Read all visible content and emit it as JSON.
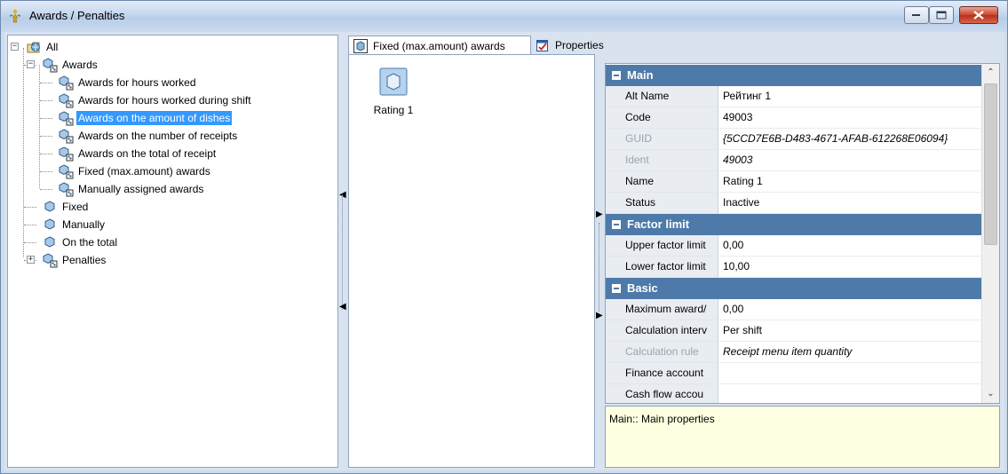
{
  "window": {
    "title": "Awards / Penalties"
  },
  "tree": {
    "rows": [
      {
        "label": "All",
        "indent": 0,
        "expander": "−",
        "icon": "folder-globe-icon",
        "selected": false
      },
      {
        "label": "Awards",
        "indent": 1,
        "expander": "−",
        "icon": "group-node-icon",
        "selected": false
      },
      {
        "label": "Awards for hours worked",
        "indent": 2,
        "expander": "",
        "icon": "group-node-icon",
        "selected": false
      },
      {
        "label": "Awards for hours worked during shift",
        "indent": 2,
        "expander": "",
        "icon": "group-node-icon",
        "selected": false
      },
      {
        "label": "Awards on the amount of dishes",
        "indent": 2,
        "expander": "",
        "icon": "group-node-icon",
        "selected": true
      },
      {
        "label": "Awards on the number of receipts",
        "indent": 2,
        "expander": "",
        "icon": "group-node-icon",
        "selected": false
      },
      {
        "label": "Awards on the total of receipt",
        "indent": 2,
        "expander": "",
        "icon": "group-node-icon",
        "selected": false
      },
      {
        "label": "Fixed (max.amount) awards",
        "indent": 2,
        "expander": "",
        "icon": "group-node-icon",
        "selected": false
      },
      {
        "label": "Manually assigned awards",
        "indent": 2,
        "expander": "",
        "icon": "group-node-icon",
        "selected": false
      },
      {
        "label": "Fixed",
        "indent": 1,
        "expander": "",
        "icon": "node-icon",
        "selected": false
      },
      {
        "label": "Manually",
        "indent": 1,
        "expander": "",
        "icon": "node-icon",
        "selected": false
      },
      {
        "label": "On the total",
        "indent": 1,
        "expander": "",
        "icon": "node-icon",
        "selected": false
      },
      {
        "label": "Penalties",
        "indent": 1,
        "expander": "+",
        "icon": "group-node-icon",
        "selected": false
      }
    ]
  },
  "tabs": [
    {
      "label": "Fixed (max.amount) awards",
      "icon": "group-node-icon",
      "active": true
    },
    {
      "label": "Properties",
      "icon": "properties-icon",
      "active": false
    }
  ],
  "list": {
    "items": [
      {
        "label": "Rating 1",
        "icon": "item-node-icon"
      }
    ]
  },
  "properties": {
    "categories": [
      {
        "name": "Main",
        "rows": [
          {
            "name": "Alt Name",
            "value": "Рейтинг 1",
            "disabled": false,
            "italic": false
          },
          {
            "name": "Code",
            "value": "49003",
            "disabled": false,
            "italic": false
          },
          {
            "name": "GUID",
            "value": "{5CCD7E6B-D483-4671-AFAB-612268E06094}",
            "disabled": true,
            "italic": true
          },
          {
            "name": "Ident",
            "value": "49003",
            "disabled": true,
            "italic": true
          },
          {
            "name": "Name",
            "value": "Rating 1",
            "disabled": false,
            "italic": false
          },
          {
            "name": "Status",
            "value": "Inactive",
            "disabled": false,
            "italic": false
          }
        ]
      },
      {
        "name": "Factor limit",
        "rows": [
          {
            "name": "Upper factor limit",
            "value": "0,00",
            "disabled": false,
            "italic": false
          },
          {
            "name": "Lower factor limit",
            "value": "10,00",
            "disabled": false,
            "italic": false
          }
        ]
      },
      {
        "name": "Basic",
        "rows": [
          {
            "name": "Maximum award/",
            "value": "0,00",
            "disabled": false,
            "italic": false
          },
          {
            "name": "Calculation interv",
            "value": "Per shift",
            "disabled": false,
            "italic": false
          },
          {
            "name": "Calculation rule",
            "value": "Receipt menu item quantity",
            "disabled": true,
            "italic": true
          },
          {
            "name": "Finance account",
            "value": "",
            "disabled": false,
            "italic": false
          },
          {
            "name": "Cash flow accou",
            "value": "",
            "disabled": false,
            "italic": false
          }
        ]
      }
    ],
    "description": "Main:: Main properties"
  },
  "colors": {
    "selection": "#3399ff",
    "category_header": "#4e7aa9",
    "description_bg": "#ffffe1"
  }
}
